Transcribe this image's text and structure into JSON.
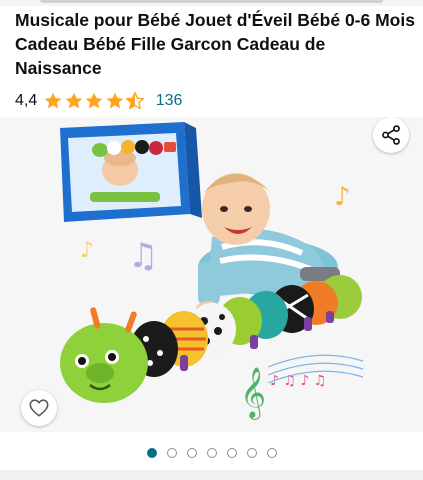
{
  "product": {
    "title": "Musicale pour Bébé Jouet d'Éveil Bébé 0-6 Mois Cadeau Bébé Fille Garcon Cadeau de Naissance",
    "rating_value": "4,4",
    "rating_stars": 4.4,
    "review_count": "136"
  },
  "gallery": {
    "image_count": 7,
    "active_index": 0,
    "share_icon": "share-icon",
    "wishlist_icon": "heart-icon"
  },
  "colors": {
    "star": "#ffa41c",
    "link": "#007185",
    "active_dot": "#007185"
  }
}
